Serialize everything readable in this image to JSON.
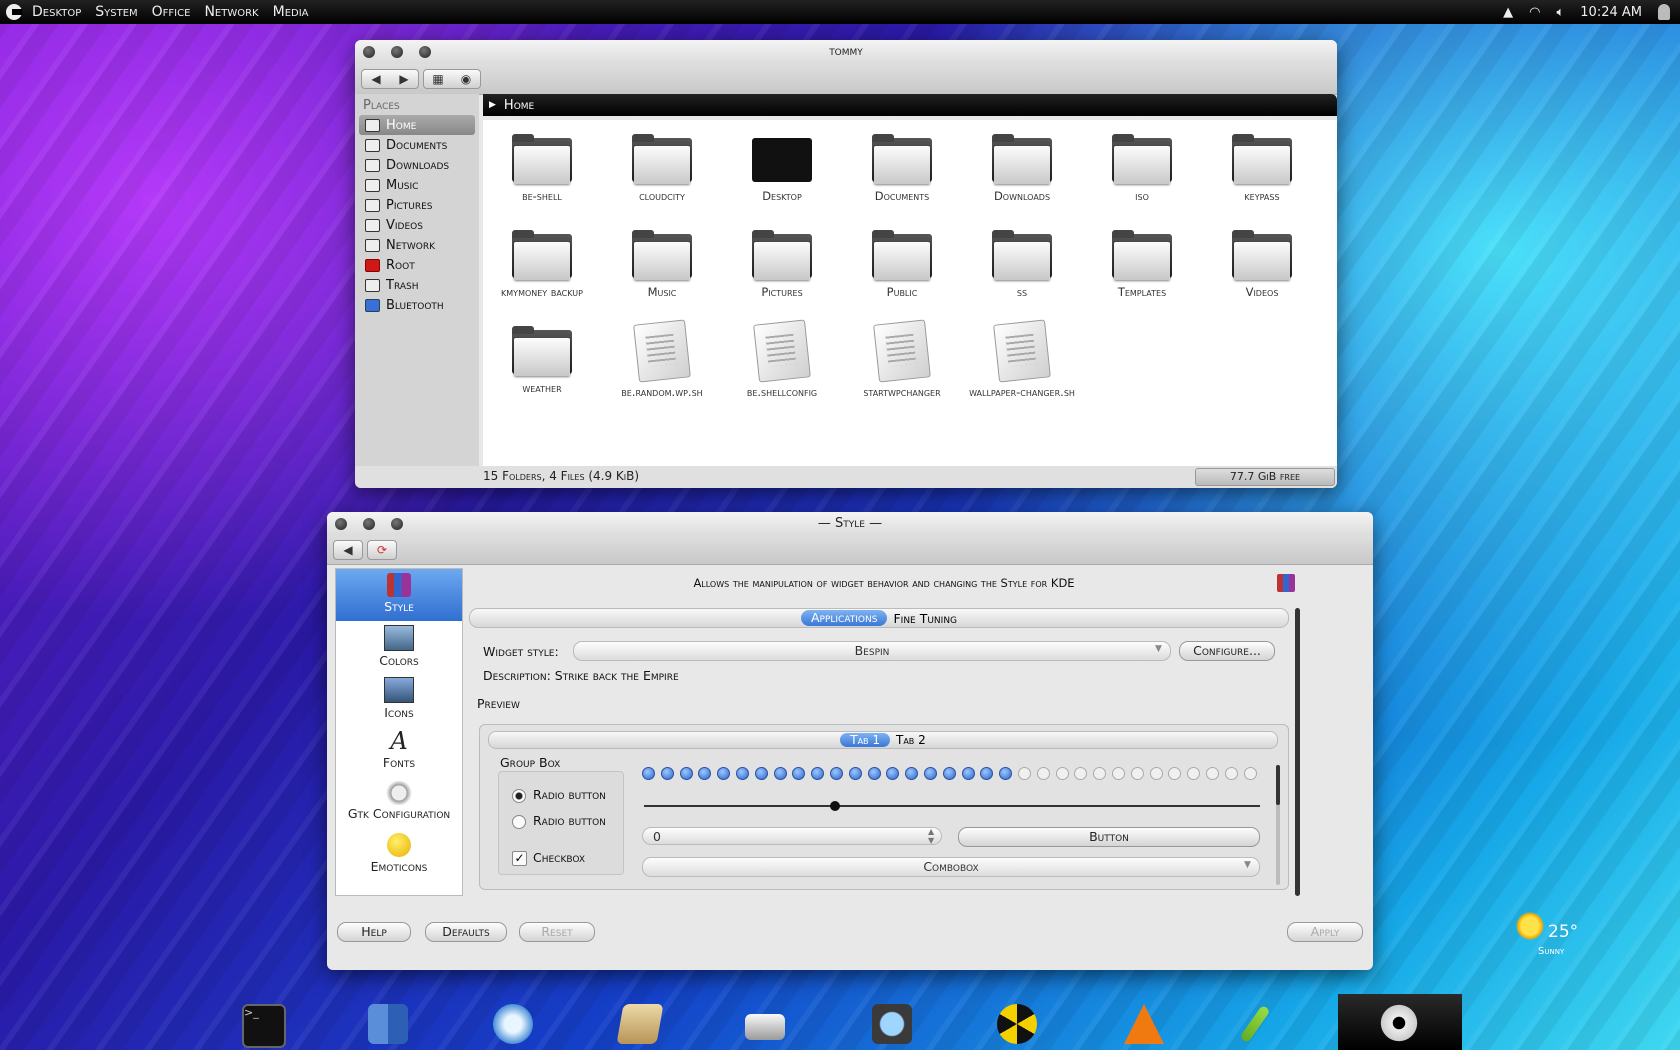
{
  "topbar": {
    "menus": [
      "Desktop",
      "System",
      "Office",
      "Network",
      "Media"
    ],
    "time": "10:24 AM"
  },
  "filemanager": {
    "title": "tommy",
    "places_header": "Places",
    "places": [
      "Home",
      "Documents",
      "Downloads",
      "Music",
      "Pictures",
      "Videos",
      "Network",
      "Root",
      "Trash",
      "Bluetooth"
    ],
    "path": "Home",
    "items": [
      {
        "label": "be-shell",
        "type": "folder"
      },
      {
        "label": "cloudcity",
        "type": "folder"
      },
      {
        "label": "Desktop",
        "type": "desktop"
      },
      {
        "label": "Documents",
        "type": "folder"
      },
      {
        "label": "Downloads",
        "type": "folder"
      },
      {
        "label": "iso",
        "type": "folder"
      },
      {
        "label": "keypass",
        "type": "folder"
      },
      {
        "label": "kmymoney backup",
        "type": "folder"
      },
      {
        "label": "Music",
        "type": "folder"
      },
      {
        "label": "Pictures",
        "type": "folder"
      },
      {
        "label": "Public",
        "type": "folder"
      },
      {
        "label": "ss",
        "type": "folder"
      },
      {
        "label": "Templates",
        "type": "folder"
      },
      {
        "label": "Videos",
        "type": "folder"
      },
      {
        "label": "weather",
        "type": "folder"
      },
      {
        "label": "be.random.wp.sh",
        "type": "script"
      },
      {
        "label": "be.shellconfig",
        "type": "doc"
      },
      {
        "label": "startwpchanger",
        "type": "script"
      },
      {
        "label": "wallpaper-changer.sh",
        "type": "script"
      }
    ],
    "status": "15 Folders, 4 Files (4.9 KiB)",
    "free": "77.7 GiB free"
  },
  "style": {
    "title": "Style",
    "categories": [
      "Style",
      "Colors",
      "Icons",
      "Fonts",
      "Gtk Configuration",
      "Emoticons"
    ],
    "description_header": "Allows the manipulation of widget behavior and changing the Style for KDE",
    "tabs": [
      "Applications",
      "Fine Tuning"
    ],
    "widget_style_label": "Widget style:",
    "widget_style_value": "Bespin",
    "configure_label": "Configure...",
    "description_line": "Description: Strike back the Empire",
    "preview_label": "Preview",
    "preview_tabs": [
      "Tab 1",
      "Tab 2"
    ],
    "group_box": "Group Box",
    "radio1": "Radio button",
    "radio2": "Radio button",
    "checkbox": "Checkbox",
    "progress_fraction": 0.6,
    "slider_fraction": 0.31,
    "spin_value": "0",
    "button_label": "Button",
    "combobox_label": "Combobox",
    "buttons": {
      "help": "Help",
      "defaults": "Defaults",
      "reset": "Reset",
      "apply": "Apply"
    }
  },
  "weather": {
    "temp": "25°",
    "condition": "Sunny"
  },
  "dock_icons": [
    "terminal-icon",
    "finder-icon",
    "safari-icon",
    "editor-icon",
    "scanner-icon",
    "tv-icon",
    "radiation-icon",
    "vlc-icon",
    "color-picker-icon",
    "system-settings-icon"
  ]
}
